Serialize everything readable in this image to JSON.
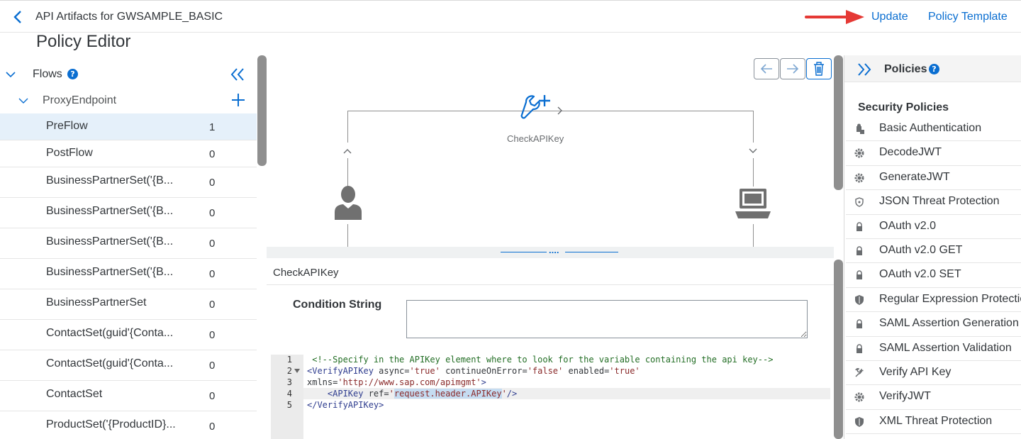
{
  "header": {
    "breadcrumb": "API Artifacts for GWSAMPLE_BASIC",
    "update_label": "Update",
    "policy_template_label": "Policy Template",
    "page_title": "Policy Editor"
  },
  "left_panel": {
    "flows_label": "Flows",
    "help_glyph": "?",
    "proxy_endpoint_label": "ProxyEndpoint",
    "flows": [
      {
        "name": "PreFlow",
        "count": "1",
        "selected": true
      },
      {
        "name": "PostFlow",
        "count": "0"
      },
      {
        "name": "BusinessPartnerSet('{B...",
        "count": "0"
      },
      {
        "name": "BusinessPartnerSet('{B...",
        "count": "0"
      },
      {
        "name": "BusinessPartnerSet('{B...",
        "count": "0"
      },
      {
        "name": "BusinessPartnerSet('{B...",
        "count": "0"
      },
      {
        "name": "BusinessPartnerSet",
        "count": "0"
      },
      {
        "name": "ContactSet(guid'{Conta...",
        "count": "0"
      },
      {
        "name": "ContactSet(guid'{Conta...",
        "count": "0"
      },
      {
        "name": "ContactSet",
        "count": "0"
      },
      {
        "name": "ProductSet('{ProductID}...",
        "count": "0"
      }
    ]
  },
  "canvas": {
    "policy_label": "CheckAPIKey",
    "splitter_grip": "....",
    "icons": [
      "arrow-left-icon",
      "arrow-right-icon",
      "trash-icon",
      "wrench-add-icon",
      "user-icon",
      "laptop-icon"
    ]
  },
  "detail": {
    "title": "CheckAPIKey",
    "condition_label": "Condition String",
    "condition_value": "",
    "code_lines": [
      {
        "num": "1",
        "text": " <!--Specify in the APIKey element where to look for the variable containing the api key-->"
      },
      {
        "num": "2",
        "text": "<VerifyAPIKey async='true' continueOnError='false' enabled='true'"
      },
      {
        "num": "3",
        "text": "xmlns='http://www.sap.com/apimgmt'>"
      },
      {
        "num": "4",
        "text": "    <APIKey ref='request.header.APIKey'/>"
      },
      {
        "num": "5",
        "text": "</VerifyAPIKey>"
      }
    ]
  },
  "right_panel": {
    "title": "Policies",
    "help_glyph": "?",
    "section_title": "Security Policies",
    "policies": [
      {
        "name": "Basic Authentication",
        "icon": "user-lock-icon"
      },
      {
        "name": "DecodeJWT",
        "icon": "gear-icon"
      },
      {
        "name": "GenerateJWT",
        "icon": "gear-icon"
      },
      {
        "name": "JSON Threat Protection",
        "icon": "shield-small-icon"
      },
      {
        "name": "OAuth v2.0",
        "icon": "lock-icon"
      },
      {
        "name": "OAuth v2.0 GET",
        "icon": "lock-icon"
      },
      {
        "name": "OAuth v2.0 SET",
        "icon": "lock-icon"
      },
      {
        "name": "Regular Expression Protection",
        "icon": "shield-icon"
      },
      {
        "name": "SAML Assertion Generation",
        "icon": "lock-icon"
      },
      {
        "name": "SAML Assertion Validation",
        "icon": "lock-icon"
      },
      {
        "name": "Verify API Key",
        "icon": "wrench-icon"
      },
      {
        "name": "VerifyJWT",
        "icon": "gear-icon"
      },
      {
        "name": "XML Threat Protection",
        "icon": "shield-icon"
      }
    ]
  },
  "colors": {
    "accent": "#0a6ed1",
    "selected_row": "#e5f0fa",
    "annotation_arrow": "#e53935"
  }
}
